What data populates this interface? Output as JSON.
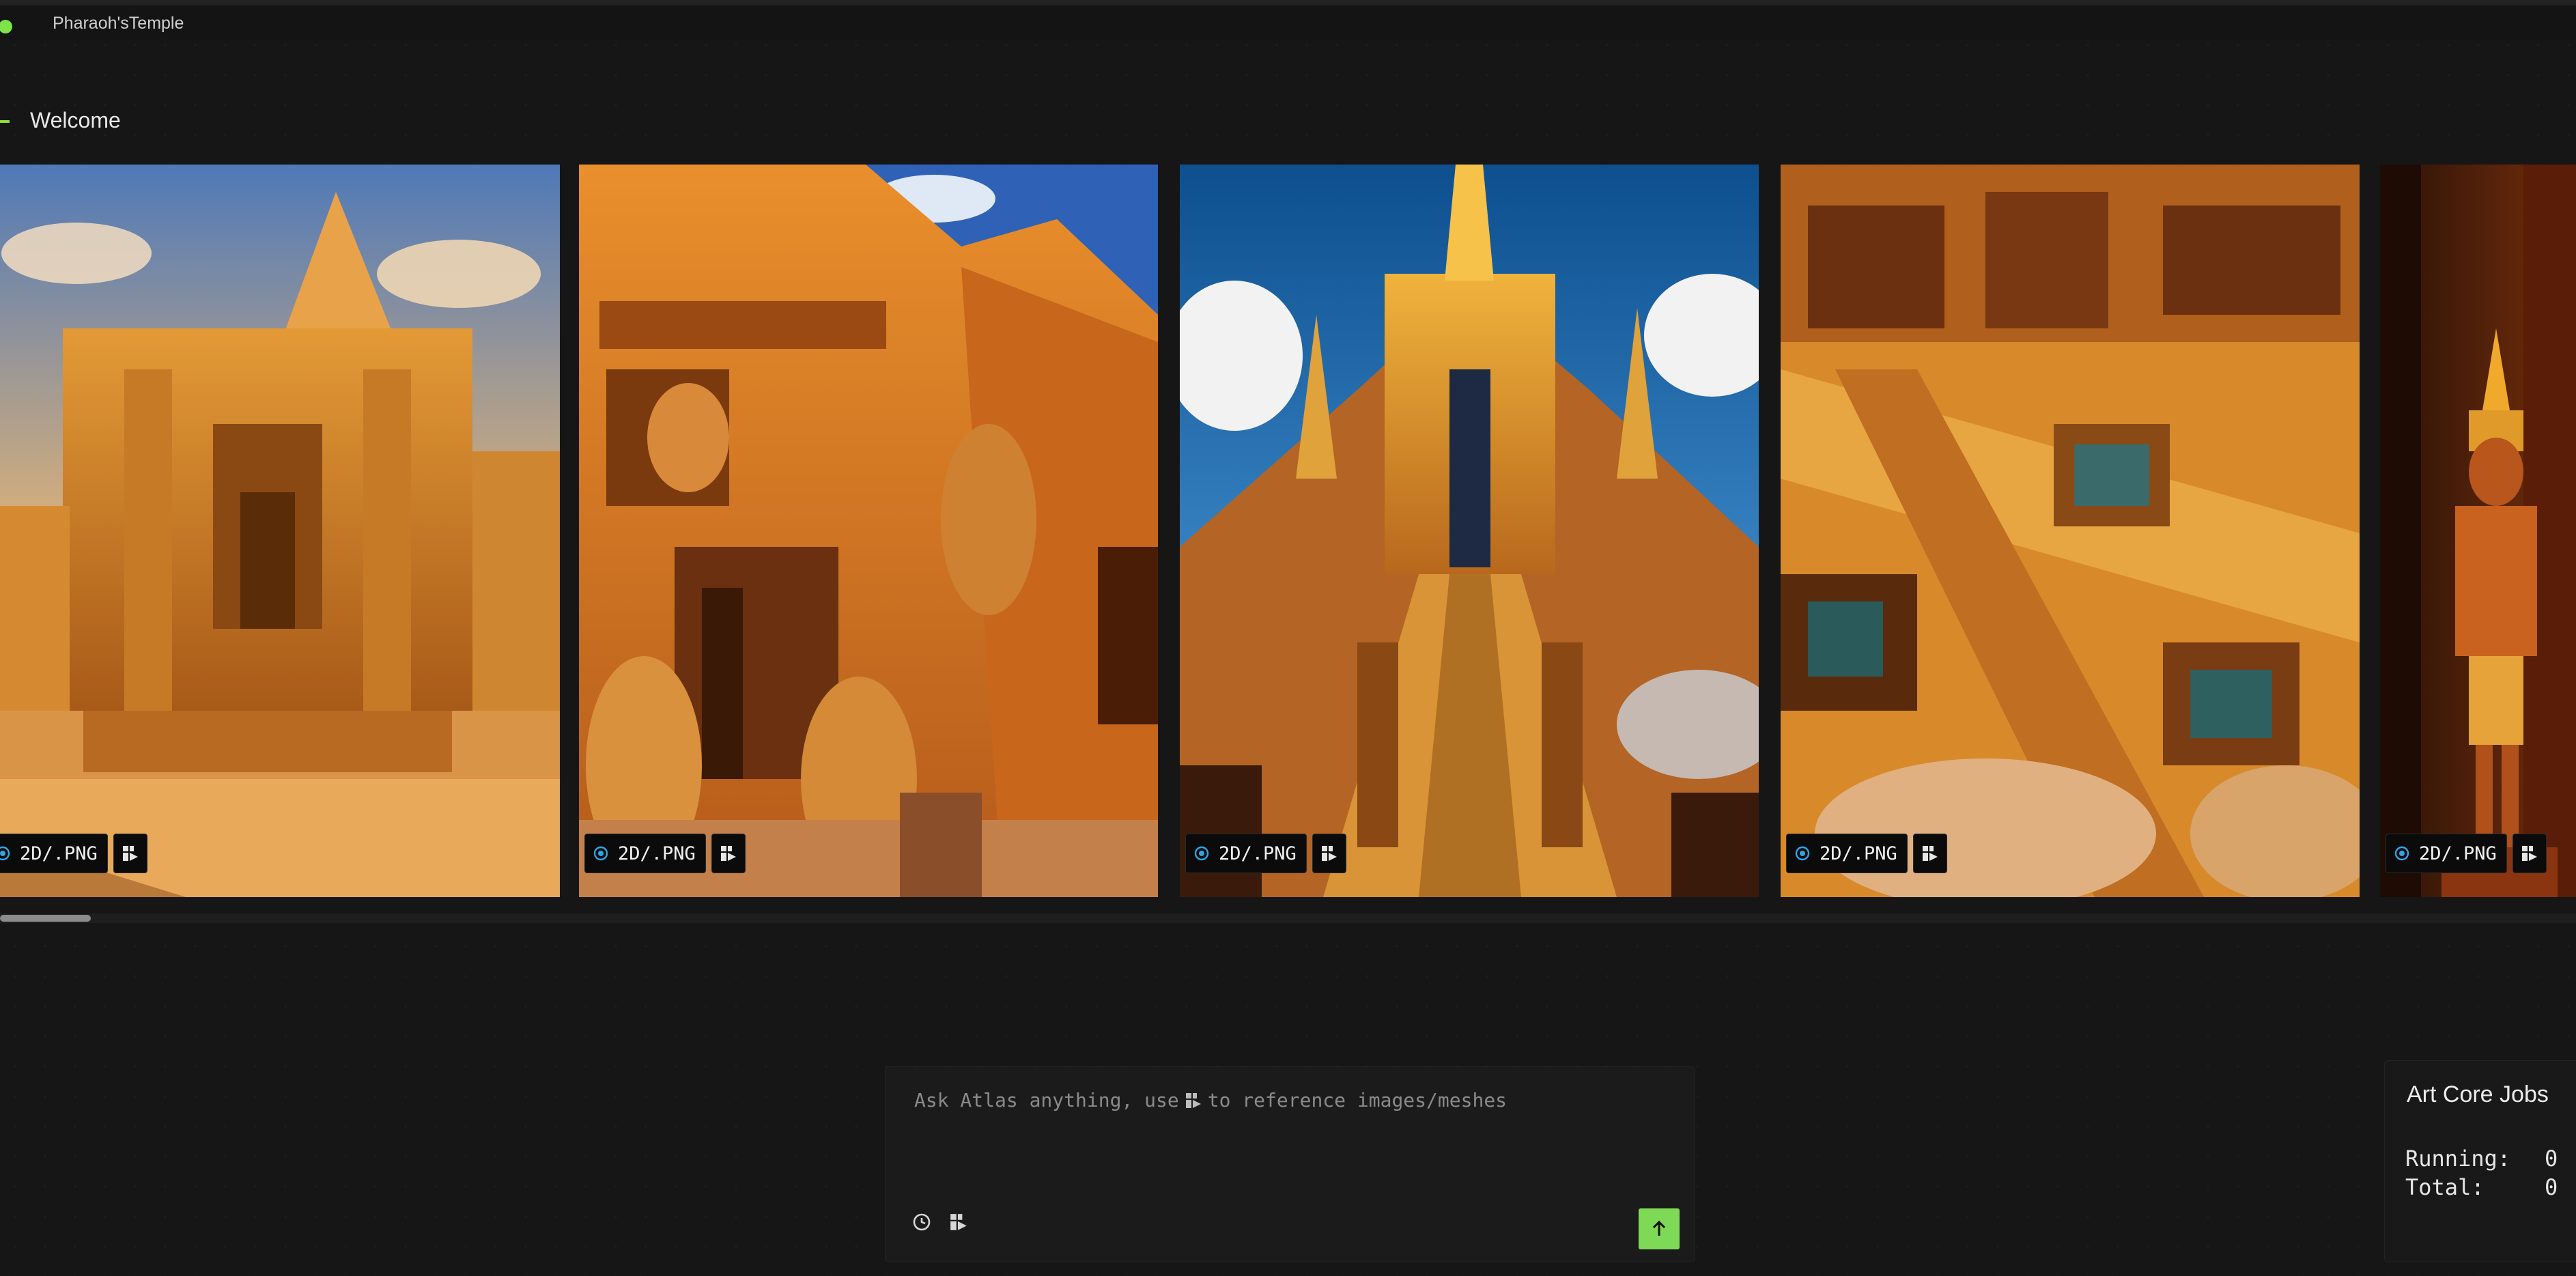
{
  "header": {
    "project_title": "Pharaoh'sTemple"
  },
  "welcome": {
    "title": "Welcome"
  },
  "gallery": {
    "cards": [
      {
        "type_label": "2D/.PNG"
      },
      {
        "type_label": "2D/.PNG"
      },
      {
        "type_label": "2D/.PNG"
      },
      {
        "type_label": "2D/.PNG"
      },
      {
        "type_label": "2D/.PNG"
      }
    ]
  },
  "chat": {
    "placeholder_pre": "Ask Atlas anything, use",
    "placeholder_post": "to reference images/meshes"
  },
  "jobs": {
    "title": "Art Core Jobs",
    "running_label": "Running:",
    "running_value": "0",
    "total_label": "Total:",
    "total_value": "0"
  },
  "colors": {
    "accent": "#7ed957",
    "background": "#161616",
    "panel": "#1b1b1b"
  },
  "icons": [
    "status-dot",
    "image-type-icon",
    "reference-icon",
    "history-icon",
    "send-arrow-icon"
  ]
}
